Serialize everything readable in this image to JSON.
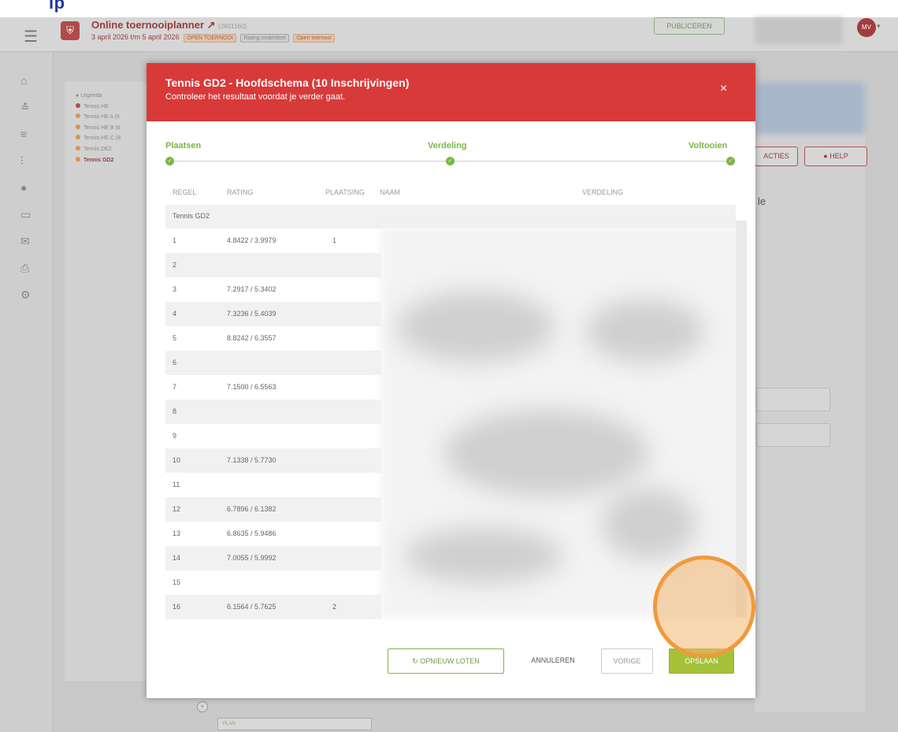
{
  "caption_fragment": "lp",
  "app": {
    "title": "Online toernooiplanner",
    "id": "(2601160)",
    "dates": "3 april 2026 t/m 5 april 2026",
    "tags": [
      "OPEN TOERNOOI",
      "Rating onderdeel",
      "Open toernooi"
    ],
    "publish_label": "PUBLICEREN",
    "avatar_initials": "MV"
  },
  "legend": {
    "title": "Legenda",
    "items": [
      {
        "label": "Tennis HE",
        "color": "#b94a4a"
      },
      {
        "label": "Tennis HE A (6",
        "color": "#d9944a"
      },
      {
        "label": "Tennis HE B (6",
        "color": "#d9944a"
      },
      {
        "label": "Tennis HE C (8",
        "color": "#d9944a"
      },
      {
        "label": "Tennis DE2",
        "color": "#d9944a"
      },
      {
        "label": "Tennis GD2",
        "color": "#d9944a"
      }
    ]
  },
  "right_panel": {
    "acties_label": "ACTIES",
    "help_label": "HELP",
    "fragment": "le"
  },
  "bottom": {
    "plan_label": "PLAN"
  },
  "modal": {
    "title": "Tennis GD2 - Hoofdschema (10 Inschrijvingen)",
    "subtitle": "Controleer het resultaat voordat je verder gaat.",
    "close": "×",
    "steps": [
      "Plaatsen",
      "Verdeling",
      "Voltooien"
    ],
    "columns": [
      "REGEL",
      "RATING",
      "PLAATSING",
      "NAAM",
      "VERDELING"
    ],
    "group": "Tennis GD2",
    "rows": [
      {
        "regel": "1",
        "rating": "4.8422 / 3.9979",
        "plaatsing": "1"
      },
      {
        "regel": "2",
        "rating": "",
        "plaatsing": ""
      },
      {
        "regel": "3",
        "rating": "7.2917 / 5.3402",
        "plaatsing": ""
      },
      {
        "regel": "4",
        "rating": "7.3236 / 5.4039",
        "plaatsing": ""
      },
      {
        "regel": "5",
        "rating": "8.8242 / 6.3557",
        "plaatsing": ""
      },
      {
        "regel": "6",
        "rating": "",
        "plaatsing": ""
      },
      {
        "regel": "7",
        "rating": "7.1500 / 6.5563",
        "plaatsing": ""
      },
      {
        "regel": "8",
        "rating": "",
        "plaatsing": ""
      },
      {
        "regel": "9",
        "rating": "",
        "plaatsing": ""
      },
      {
        "regel": "10",
        "rating": "7.1338 / 5.7730",
        "plaatsing": ""
      },
      {
        "regel": "11",
        "rating": "",
        "plaatsing": ""
      },
      {
        "regel": "12",
        "rating": "6.7896 / 6.1382",
        "plaatsing": ""
      },
      {
        "regel": "13",
        "rating": "6.8635 / 5.9486",
        "plaatsing": ""
      },
      {
        "regel": "14",
        "rating": "7.0055 / 5.9992",
        "plaatsing": ""
      },
      {
        "regel": "15",
        "rating": "",
        "plaatsing": ""
      },
      {
        "regel": "16",
        "rating": "6.1564 / 5.7625",
        "plaatsing": "2"
      }
    ],
    "buttons": {
      "redraw": "OPNIEUW LOTEN",
      "cancel": "ANNULEREN",
      "prev": "VORIGE",
      "save": "OPSLAAN"
    }
  },
  "colors": {
    "header_red": "#d83a3a",
    "step_green": "#7ab648",
    "save_green": "#a5c13a",
    "highlight_orange": "#f19a3c"
  }
}
